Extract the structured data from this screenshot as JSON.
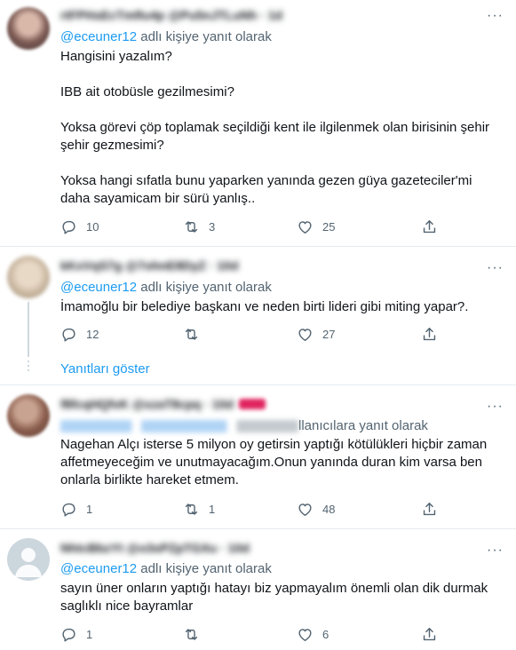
{
  "tweets": [
    {
      "reply_prefix_mention": "@eceuner12",
      "reply_suffix": " adlı kişiye yanıt olarak",
      "header_blurred": "rtFPHsEcTmfIu4p  @Pu5nJTLuNh  · 1d",
      "text": "Hangisini yazalım?\n\nIBB ait otobüsle gezilmesimi?\n\nYoksa görevi çöp toplamak seçildiği kent ile ilgilenmek olan birisinin şehir şehir gezmesimi?\n\nYoksa hangi sıfatla bunu yaparken yanında gezen güya gazeteciler'mi daha sayamicam bir sürü yanlış..",
      "replies": "10",
      "retweets": "3",
      "likes": "25"
    },
    {
      "reply_prefix_mention": "@eceuner12",
      "reply_suffix": " adlı kişiye yanıt olarak",
      "header_blurred": "kKxVqS7g  @7ohnE8DyZ  · 10d",
      "text": "İmamoğlu bir belediye başkanı ve neden birti lideri gibi miting yapar?.",
      "replies": "12",
      "retweets": "",
      "likes": "27",
      "show_replies": "Yanıtları göster"
    },
    {
      "reply_suffix_partial": "llanıcılara yanıt olarak",
      "header_blurred": "f8fcqHQfvK  @xzaT8cpq  · 10d",
      "text": "Nagehan Alçı isterse 5 milyon oy getirsin yaptığı kötülükleri hiçbir zaman affetmeyeceğim ve unutmayacağım.Onun yanında duran kim varsa ben onlarla birlikte hareket etmem.",
      "replies": "1",
      "retweets": "1",
      "likes": "48"
    },
    {
      "reply_prefix_mention": "@eceuner12",
      "reply_suffix": " adlı kişiye yanıt olarak",
      "header_blurred": "NhtcBbzYt  @o3sPZpTGXu  · 10d",
      "text": "sayın üner onların yaptığı hatayı biz yapmayalım önemli olan dik durmak saglıklı nice bayramlar",
      "replies": "1",
      "retweets": "",
      "likes": "6"
    }
  ],
  "icons": {
    "reply": "reply-icon",
    "retweet": "retweet-icon",
    "like": "heart-icon",
    "share": "share-icon",
    "more": "more-icon"
  },
  "colors": {
    "accent": "#1d9bf0",
    "muted": "#536471",
    "divider": "#e6ecf0"
  }
}
